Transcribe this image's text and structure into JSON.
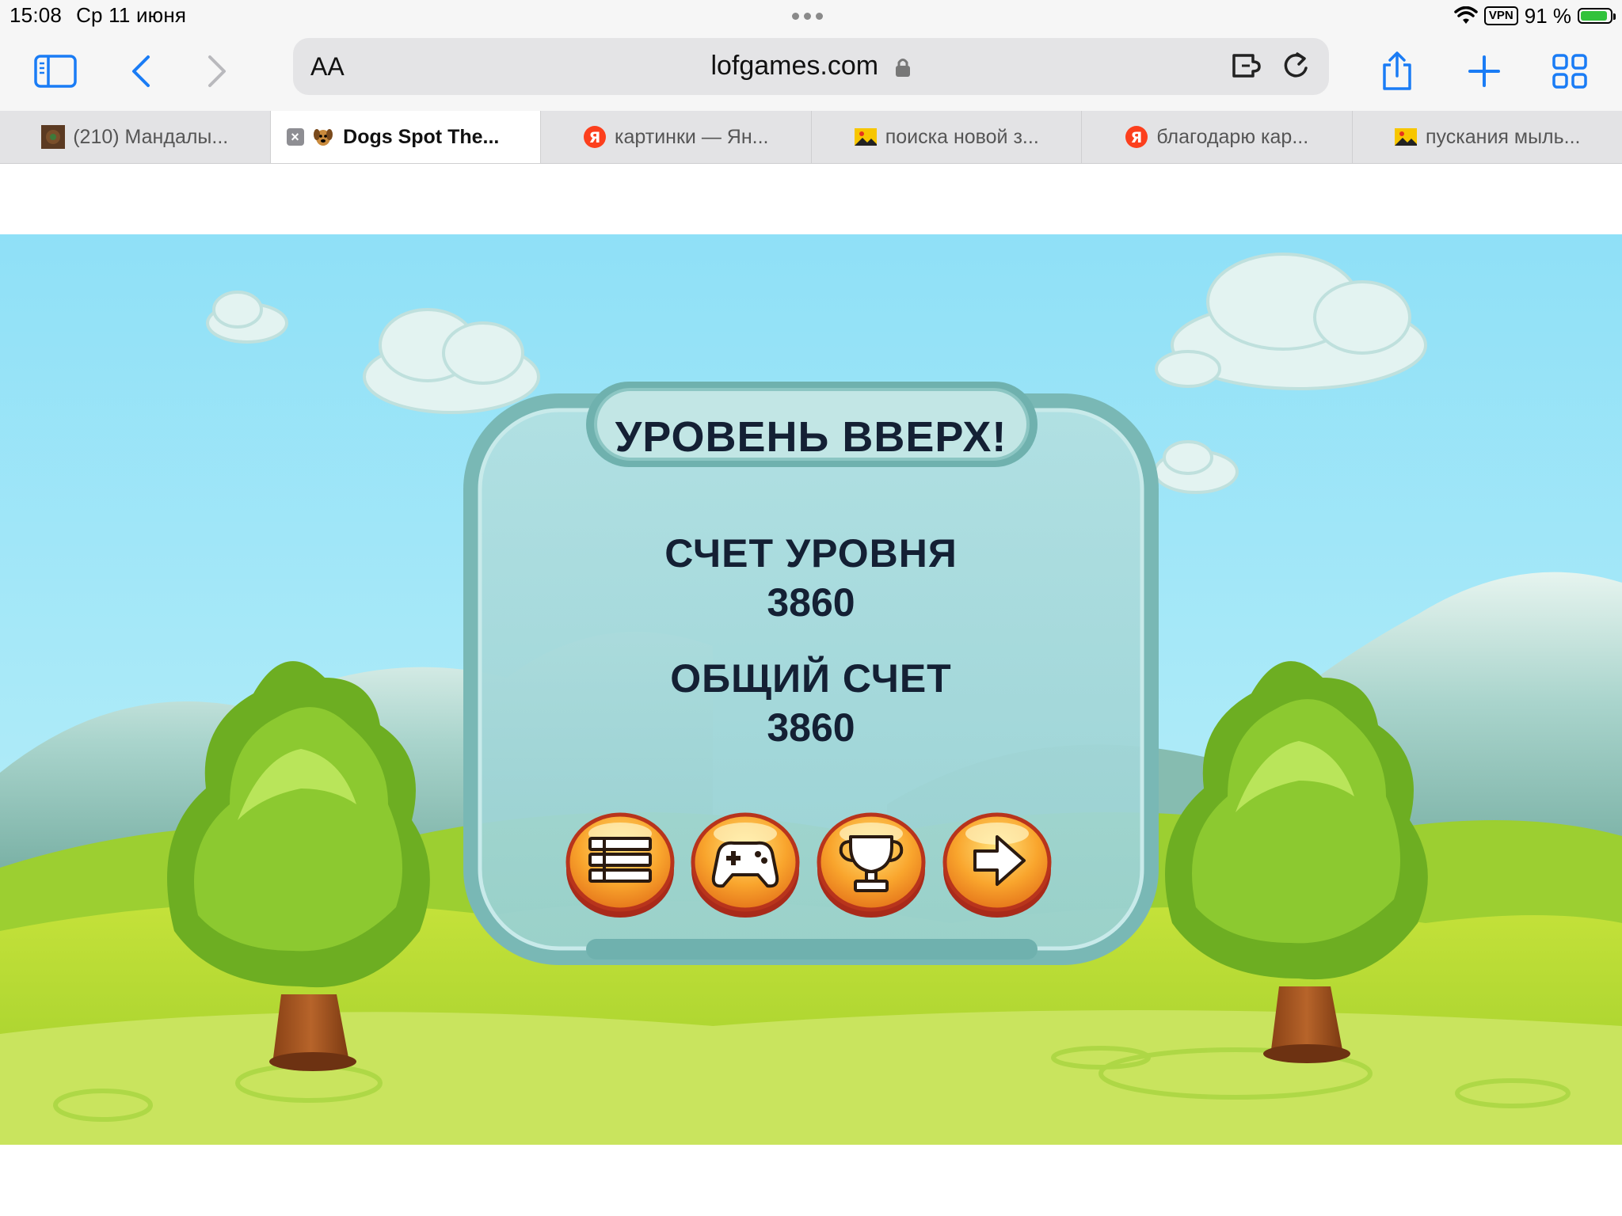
{
  "status_bar": {
    "time": "15:08",
    "date": "Ср 11 июня",
    "vpn": "VPN",
    "battery": "91 %",
    "battery_level": 0.91
  },
  "browser": {
    "aa_label": "AA",
    "url": "lofgames.com",
    "icons": {
      "sidebar": "sidebar-icon",
      "back": "back-chevron-icon",
      "forward": "forward-chevron-icon",
      "extension": "extension-icon",
      "reload": "reload-icon",
      "share": "share-icon",
      "new_tab": "plus-icon",
      "tab_overview": "tab-grid-icon",
      "lock": "lock-icon"
    },
    "accent_color": "#1a7cf5"
  },
  "tabs": [
    {
      "title": "(210) Мандалы...",
      "favicon": "mandala-thumbnail-icon",
      "active": false
    },
    {
      "title": "Dogs Spot The...",
      "favicon": "dog-icon",
      "active": true
    },
    {
      "title": "картинки — Ян...",
      "favicon": "yandex-icon",
      "active": false
    },
    {
      "title": "поиска новой з...",
      "favicon": "image-icon",
      "active": false
    },
    {
      "title": "благодарю  кар...",
      "favicon": "yandex-icon",
      "active": false
    },
    {
      "title": "пускания мыль...",
      "favicon": "image-icon",
      "active": false
    }
  ],
  "game": {
    "title": "УРОВЕНЬ ВВЕРХ!",
    "level_score_label": "СЧЕТ УРОВНЯ",
    "level_score": "3860",
    "total_score_label": "ОБЩИЙ СЧЕТ",
    "total_score": "3860",
    "buttons": [
      {
        "name": "menu-button",
        "icon": "list-menu-icon"
      },
      {
        "name": "more-games-button",
        "icon": "gamepad-icon"
      },
      {
        "name": "leaderboard-button",
        "icon": "trophy-icon"
      },
      {
        "name": "next-level-button",
        "icon": "arrow-right-icon"
      }
    ]
  }
}
